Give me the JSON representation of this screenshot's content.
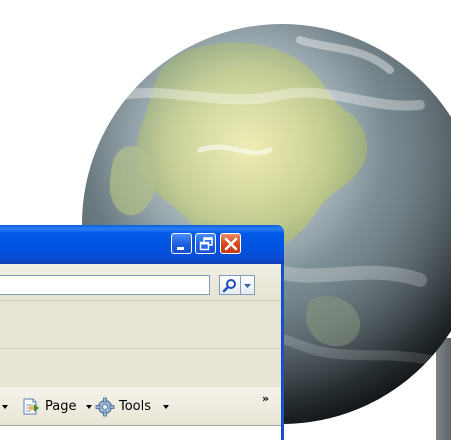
{
  "window": {
    "minimize_icon": "minimize-icon",
    "restore_icon": "restore-icon",
    "close_icon": "close-icon",
    "titlebar_color": "#0054e1",
    "close_color": "#d54a1e"
  },
  "address_bar": {
    "value": "",
    "search_icon": "magnifier-icon",
    "dropdown_icon": "chevron-down-icon"
  },
  "command_bar": {
    "page_label": "Page",
    "tools_label": "Tools",
    "overflow_label": "»"
  },
  "desktop": {
    "globe": "earth-globe-image"
  }
}
